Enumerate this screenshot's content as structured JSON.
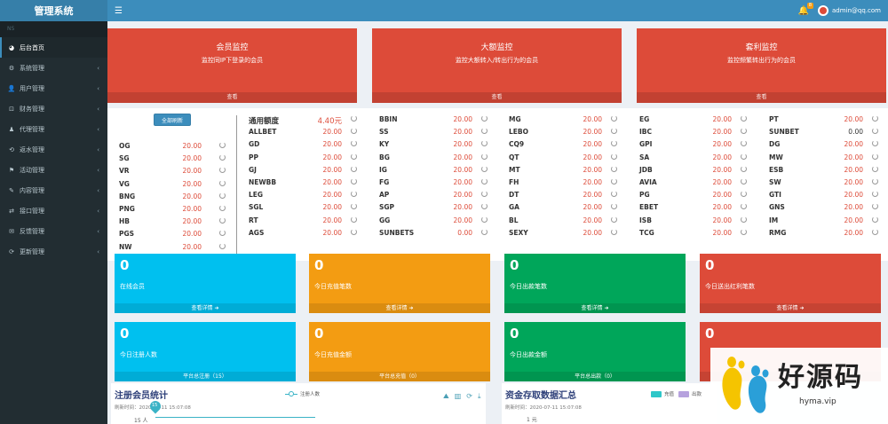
{
  "app": {
    "title": "管理系统"
  },
  "header": {
    "notif_count": "8",
    "user_email": "admin@qq.com"
  },
  "sidebar": {
    "nav_header": "NS",
    "items": [
      {
        "icon": "dashboard-icon",
        "glyph": "◕",
        "label": "后台首页"
      },
      {
        "icon": "gear-icon",
        "glyph": "⚙",
        "label": "系统管理"
      },
      {
        "icon": "users-icon",
        "glyph": "👤",
        "label": "用户管理"
      },
      {
        "icon": "money-icon",
        "glyph": "⊡",
        "label": "财务管理"
      },
      {
        "icon": "agent-icon",
        "glyph": "♟",
        "label": "代理管理"
      },
      {
        "icon": "rebate-icon",
        "glyph": "⟲",
        "label": "返水管理"
      },
      {
        "icon": "activity-icon",
        "glyph": "⚑",
        "label": "活动管理"
      },
      {
        "icon": "content-icon",
        "glyph": "✎",
        "label": "内容管理"
      },
      {
        "icon": "api-icon",
        "glyph": "⇄",
        "label": "接口管理"
      },
      {
        "icon": "feedback-icon",
        "glyph": "✉",
        "label": "反馈管理"
      },
      {
        "icon": "update-icon",
        "glyph": "⟳",
        "label": "更新管理"
      }
    ]
  },
  "monitors": [
    {
      "title": "会员监控",
      "subtitle": "监控同IP下登录的会员",
      "footer": "查看"
    },
    {
      "title": "大额监控",
      "subtitle": "监控大额转入/转出行为的会员",
      "footer": "查看"
    },
    {
      "title": "套利监控",
      "subtitle": "监控频繁转出行为的会员",
      "footer": "查看"
    }
  ],
  "platforms": {
    "refresh_label": "全部刷新",
    "col1": [
      {
        "n": "OG",
        "v": "20.00"
      },
      {
        "n": "SG",
        "v": "20.00"
      },
      {
        "n": "VR",
        "v": "20.00"
      },
      {
        "n": "VG",
        "v": "20.00"
      },
      {
        "n": "BNG",
        "v": "20.00"
      },
      {
        "n": "PNG",
        "v": "20.00"
      },
      {
        "n": "HB",
        "v": "20.00"
      },
      {
        "n": "PGS",
        "v": "20.00"
      },
      {
        "n": "NW",
        "v": "20.00"
      }
    ],
    "col2": [
      {
        "n": "通用额度",
        "v": "4.40元"
      },
      {
        "n": "ALLBET",
        "v": "20.00"
      },
      {
        "n": "GD",
        "v": "20.00"
      },
      {
        "n": "PP",
        "v": "20.00"
      },
      {
        "n": "GJ",
        "v": "20.00"
      },
      {
        "n": "NEWBB",
        "v": "20.00"
      },
      {
        "n": "LEG",
        "v": "20.00"
      },
      {
        "n": "SGL",
        "v": "20.00"
      },
      {
        "n": "RT",
        "v": "20.00"
      },
      {
        "n": "AGS",
        "v": "20.00"
      }
    ],
    "col3": [
      {
        "n": "BBIN",
        "v": "20.00"
      },
      {
        "n": "SS",
        "v": "20.00"
      },
      {
        "n": "KY",
        "v": "20.00"
      },
      {
        "n": "BG",
        "v": "20.00"
      },
      {
        "n": "IG",
        "v": "20.00"
      },
      {
        "n": "FG",
        "v": "20.00"
      },
      {
        "n": "AP",
        "v": "20.00"
      },
      {
        "n": "SGP",
        "v": "20.00"
      },
      {
        "n": "GG",
        "v": "20.00"
      },
      {
        "n": "SUNBETS",
        "v": "0.00"
      }
    ],
    "col4": [
      {
        "n": "MG",
        "v": "20.00"
      },
      {
        "n": "LEBO",
        "v": "20.00"
      },
      {
        "n": "CQ9",
        "v": "20.00"
      },
      {
        "n": "QT",
        "v": "20.00"
      },
      {
        "n": "MT",
        "v": "20.00"
      },
      {
        "n": "FH",
        "v": "20.00"
      },
      {
        "n": "DT",
        "v": "20.00"
      },
      {
        "n": "GA",
        "v": "20.00"
      },
      {
        "n": "BL",
        "v": "20.00"
      },
      {
        "n": "SEXY",
        "v": "20.00"
      }
    ],
    "col5": [
      {
        "n": "EG",
        "v": "20.00"
      },
      {
        "n": "IBC",
        "v": "20.00"
      },
      {
        "n": "GPI",
        "v": "20.00"
      },
      {
        "n": "SA",
        "v": "20.00"
      },
      {
        "n": "JDB",
        "v": "20.00"
      },
      {
        "n": "AVIA",
        "v": "20.00"
      },
      {
        "n": "PG",
        "v": "20.00"
      },
      {
        "n": "EBET",
        "v": "20.00"
      },
      {
        "n": "ISB",
        "v": "20.00"
      },
      {
        "n": "TCG",
        "v": "20.00"
      }
    ],
    "col6": [
      {
        "n": "PT",
        "v": "20.00"
      },
      {
        "n": "SUNBET",
        "v": "0.00"
      },
      {
        "n": "DG",
        "v": "20.00"
      },
      {
        "n": "MW",
        "v": "20.00"
      },
      {
        "n": "ESB",
        "v": "20.00"
      },
      {
        "n": "SW",
        "v": "20.00"
      },
      {
        "n": "GTI",
        "v": "20.00"
      },
      {
        "n": "GNS",
        "v": "20.00"
      },
      {
        "n": "IM",
        "v": "20.00"
      },
      {
        "n": "RMG",
        "v": "20.00"
      }
    ]
  },
  "stats": [
    {
      "value": "0",
      "label": "在线会员",
      "footer": "查看详情 ➜",
      "color": "#00c0ef"
    },
    {
      "value": "0",
      "label": "今日充值笔数",
      "footer": "查看详情 ➜",
      "color": "#f39c12"
    },
    {
      "value": "0",
      "label": "今日出款笔数",
      "footer": "查看详情 ➜",
      "color": "#00a65a"
    },
    {
      "value": "0",
      "label": "今日送出红利笔数",
      "footer": "查看详情 ➜",
      "color": "#dd4b39"
    },
    {
      "value": "0",
      "label": "今日注册人数",
      "footer": "平台总注册（15）",
      "color": "#00c0ef"
    },
    {
      "value": "0",
      "label": "今日充值金额",
      "footer": "平台总充值（0）",
      "color": "#f39c12"
    },
    {
      "value": "0",
      "label": "今日出款金额",
      "footer": "平台总出款（0）",
      "color": "#00a65a"
    },
    {
      "value": "0",
      "label": "",
      "footer": "",
      "color": "#dd4b39"
    }
  ],
  "charts": {
    "register": {
      "title": "注册会员统计",
      "time": "刷新时间：2020-07-11 15:07:08",
      "legend": "注册人数",
      "ytick": "15 人",
      "marker": "15"
    },
    "funds": {
      "title": "资金存取数据汇总",
      "time": "刷新时间：2020-07-11 15:07:08",
      "legend1": "充值",
      "legend2": "出款",
      "ytick": "1 元"
    }
  },
  "watermark": {
    "text": "好源码",
    "url": "hyma.vip"
  }
}
